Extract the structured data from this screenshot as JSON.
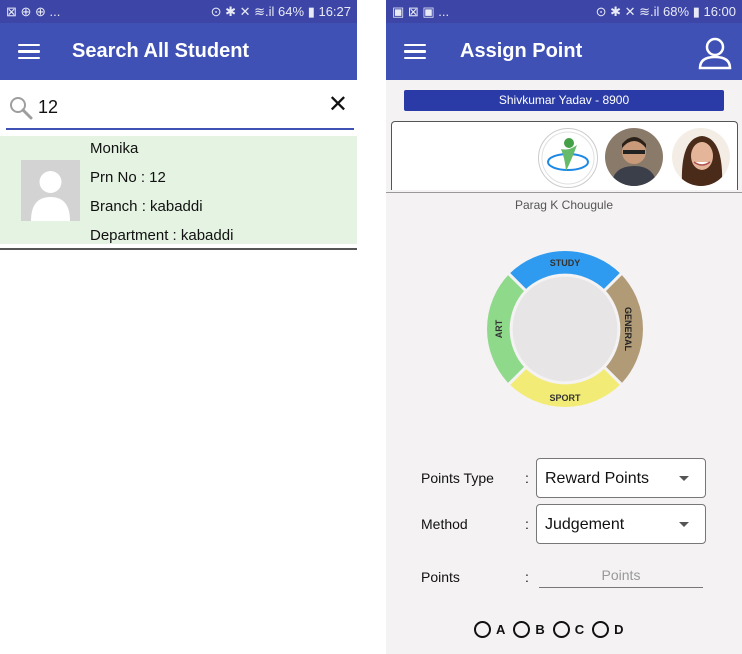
{
  "left": {
    "status_left": "⊠ ⊕ ⊕ ...",
    "status_right": "⊙ ✱ ✕ ≋.il 64% ▮ 16:27",
    "title": "Search All Student",
    "search_value": "12",
    "result": {
      "name": "Monika",
      "prn": "Prn No : 12",
      "branch": "Branch : kabaddi",
      "department": "Department : kabaddi"
    }
  },
  "right": {
    "status_left": "▣ ⊠ ▣ ...",
    "status_right": "⊙ ✱ ✕ ≋.il 68% ▮ 16:00",
    "title": "Assign Point",
    "student_bar": "Shivkumar  Yadav - 8900",
    "teacher_name": "Parag K Chougule",
    "wheel": {
      "top": "STUDY",
      "right": "GENERAL",
      "bottom": "SPORT",
      "left": "ART"
    },
    "form": {
      "points_type_label": "Points Type",
      "points_type_value": "Reward Points",
      "method_label": "Method",
      "method_value": "Judgement",
      "points_label": "Points",
      "points_placeholder": "Points",
      "colon": ":"
    },
    "radios": [
      "A",
      "B",
      "C",
      "D"
    ]
  },
  "colors": {
    "appbar": "#3f51b5",
    "statusbar": "#3d46a6",
    "card_bg": "#e4f3e2",
    "study": "#2f9bf0",
    "general": "#b19b77",
    "sport": "#f2ec76",
    "art": "#8fd98b"
  }
}
